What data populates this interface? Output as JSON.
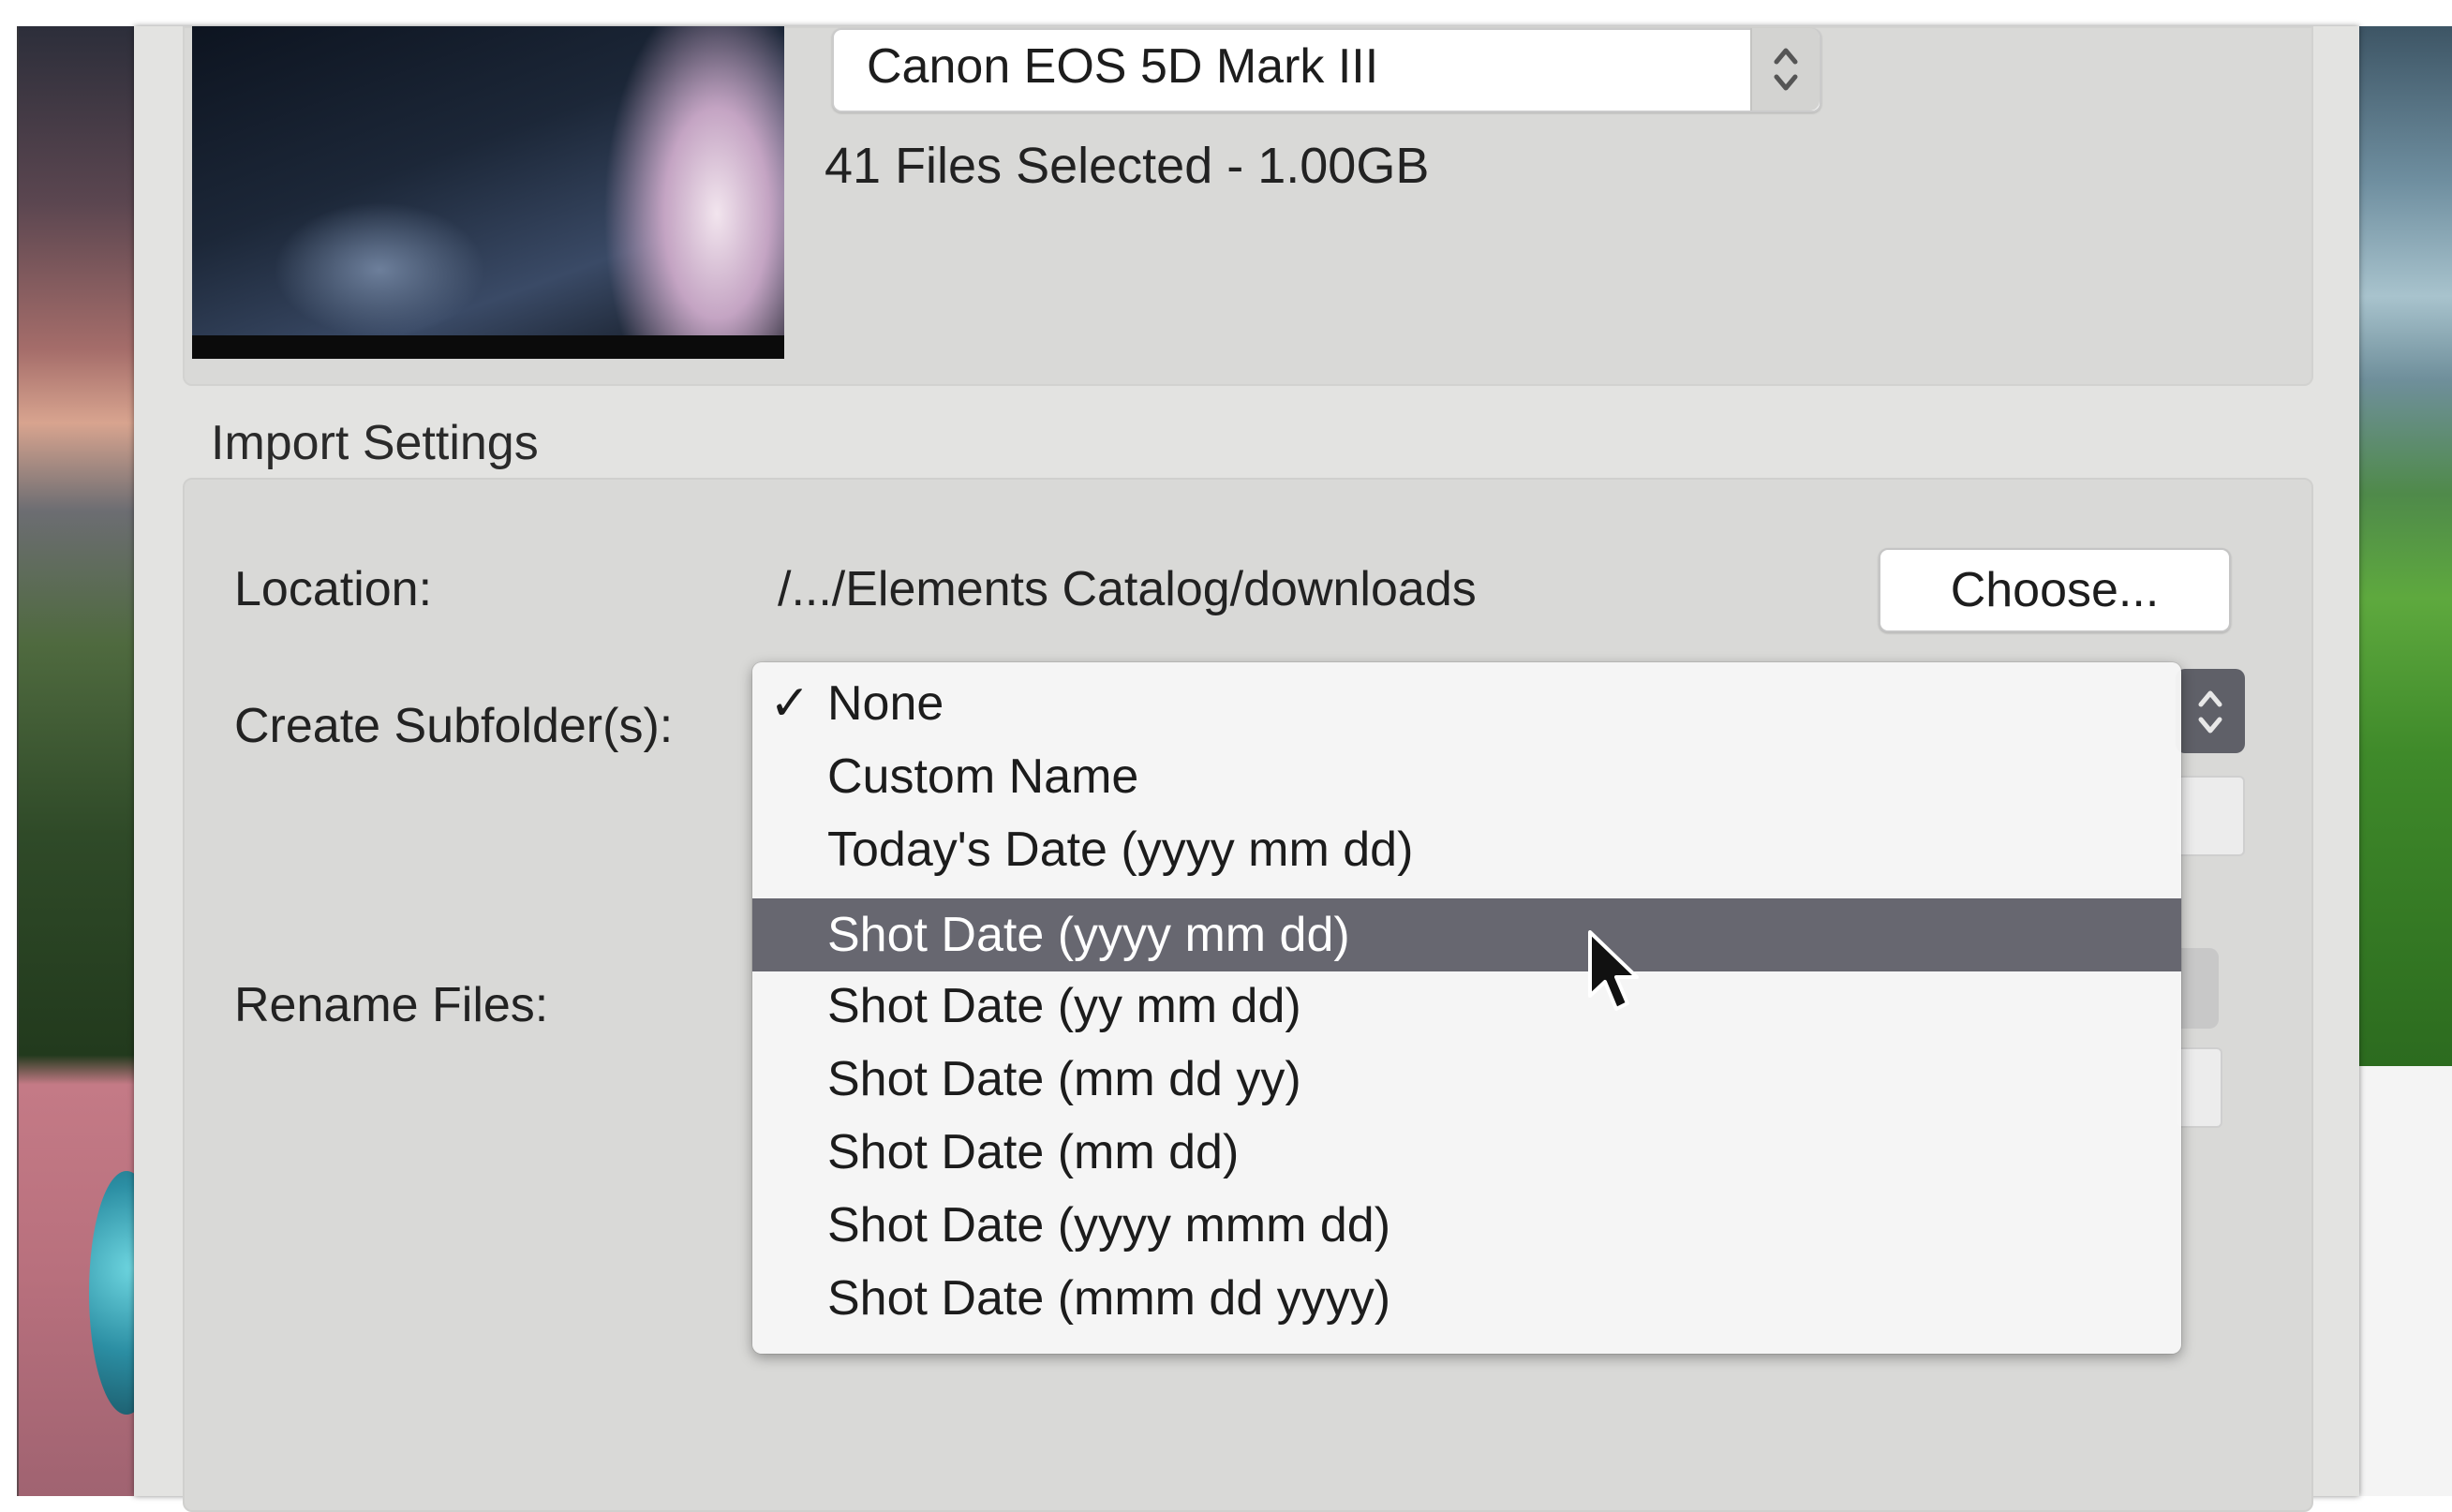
{
  "camera": {
    "selected_device": "Canon EOS 5D Mark III",
    "files_selected": "41 Files Selected - 1.00GB"
  },
  "import_settings": {
    "section_title": "Import Settings",
    "location_label": "Location:",
    "location_path": "/.../Elements Catalog/downloads",
    "choose_button": "Choose...",
    "subfolder_label": "Create Subfolder(s):",
    "rename_label": "Rename Files:"
  },
  "subfolder_menu": {
    "checkmark": "✓",
    "checked_index": 0,
    "highlighted_index": 3,
    "items": [
      "None",
      "Custom Name",
      "Today's Date (yyyy mm dd)",
      "Shot Date (yyyy mm dd)",
      "Shot Date (yy mm dd)",
      "Shot Date (mm dd yy)",
      "Shot Date (mm dd)",
      "Shot Date (yyyy mmm dd)",
      "Shot Date (mmm dd yyyy)"
    ]
  },
  "colors": {
    "dialog_background": "#e3e3e1",
    "menu_highlight": "#676770"
  },
  "icons": {
    "stepper": "chevron-up-down-icon",
    "check": "checkmark-icon",
    "cursor": "mouse-pointer-icon"
  }
}
